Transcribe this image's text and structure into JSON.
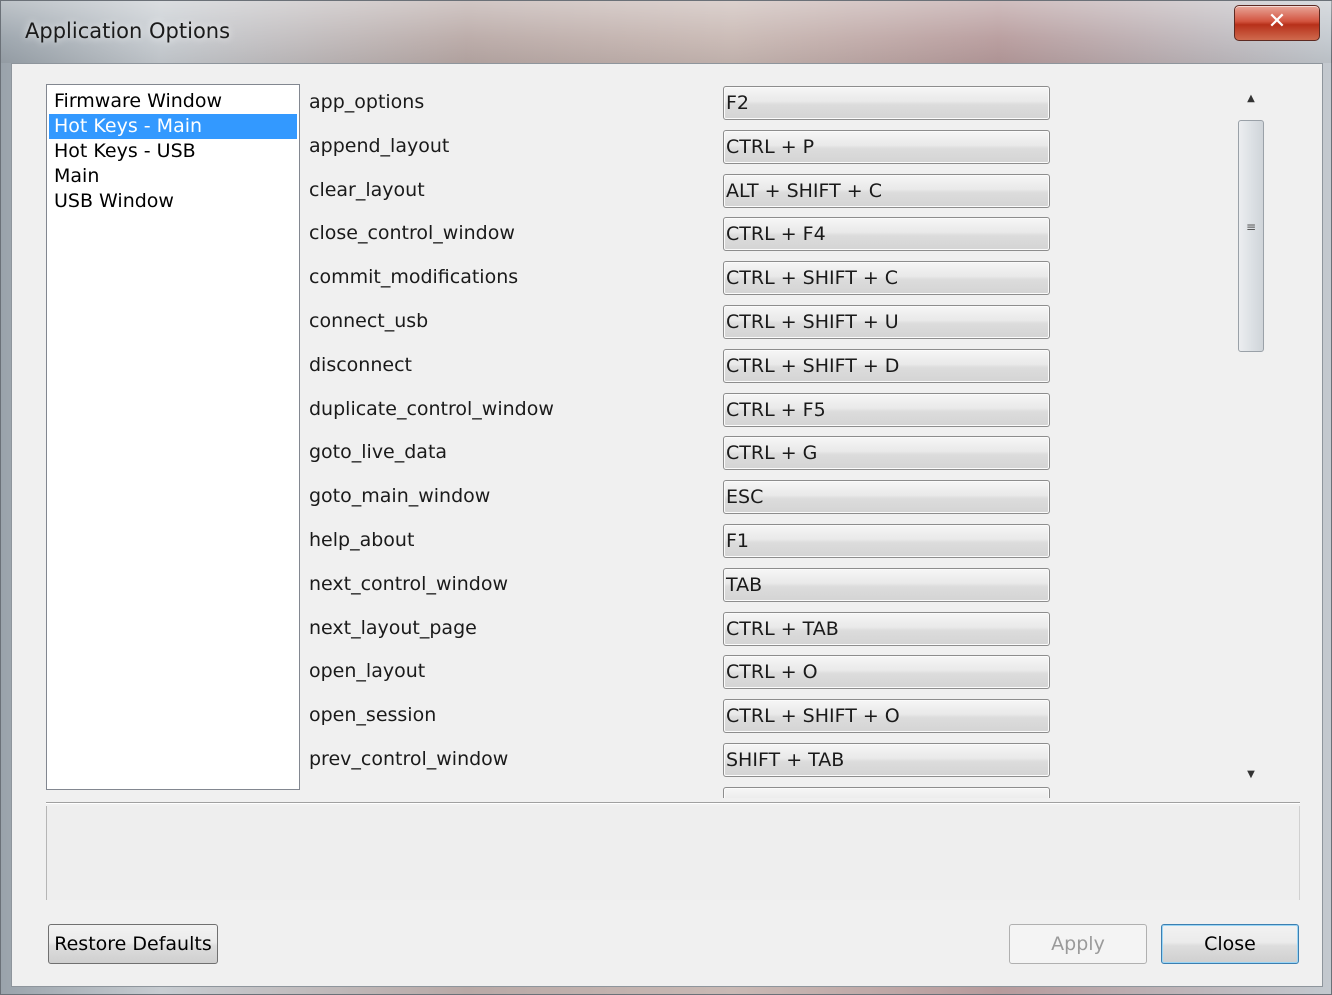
{
  "window": {
    "title": "Application Options",
    "close_glyph": "✕"
  },
  "categories": [
    {
      "label": "Firmware Window",
      "selected": false
    },
    {
      "label": "Hot Keys - Main",
      "selected": true
    },
    {
      "label": "Hot Keys - USB",
      "selected": false
    },
    {
      "label": "Main",
      "selected": false
    },
    {
      "label": "USB Window",
      "selected": false
    }
  ],
  "hotkeys": [
    {
      "action": "app_options",
      "key": "F2"
    },
    {
      "action": "append_layout",
      "key": "CTRL + P"
    },
    {
      "action": "clear_layout",
      "key": "ALT + SHIFT + C"
    },
    {
      "action": "close_control_window",
      "key": "CTRL + F4"
    },
    {
      "action": "commit_modifications",
      "key": "CTRL + SHIFT + C"
    },
    {
      "action": "connect_usb",
      "key": "CTRL + SHIFT + U"
    },
    {
      "action": "disconnect",
      "key": "CTRL + SHIFT + D"
    },
    {
      "action": "duplicate_control_window",
      "key": "CTRL + F5"
    },
    {
      "action": "goto_live_data",
      "key": "CTRL + G"
    },
    {
      "action": "goto_main_window",
      "key": "ESC"
    },
    {
      "action": "help_about",
      "key": "F1"
    },
    {
      "action": "next_control_window",
      "key": "TAB"
    },
    {
      "action": "next_layout_page",
      "key": "CTRL + TAB"
    },
    {
      "action": "open_layout",
      "key": "CTRL + O"
    },
    {
      "action": "open_session",
      "key": "CTRL + SHIFT + O"
    },
    {
      "action": "prev_control_window",
      "key": "SHIFT + TAB"
    },
    {
      "action": "",
      "key": ""
    }
  ],
  "scrollbar": {
    "up_glyph": "▲",
    "down_glyph": "▼",
    "grip_glyph": "≡"
  },
  "buttons": {
    "restore_defaults": "Restore Defaults",
    "apply": "Apply",
    "close": "Close"
  },
  "colors": {
    "selection": "#3399ff",
    "close_button": "#c8412a"
  }
}
